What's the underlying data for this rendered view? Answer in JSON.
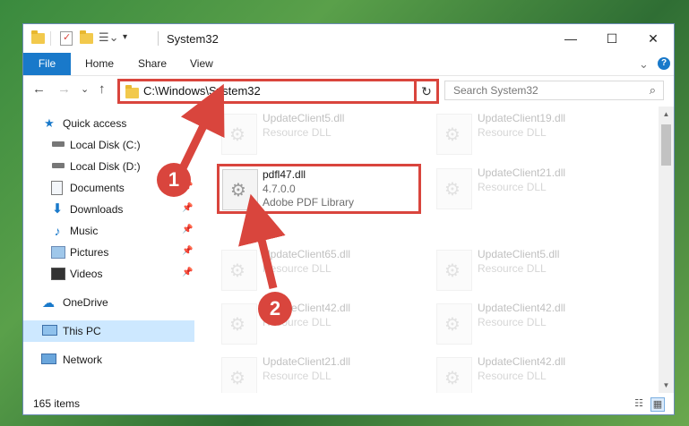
{
  "window": {
    "title": "System32",
    "controls": {
      "minimize": "—",
      "maximize": "☐",
      "close": "✕"
    }
  },
  "ribbon": {
    "tabs": [
      "File",
      "Home",
      "Share",
      "View"
    ],
    "expand": "⌄",
    "help": "?"
  },
  "nav": {
    "back": "←",
    "forward": "→",
    "recent": "⌄",
    "up": "↑"
  },
  "address": {
    "path": "C:\\Windows\\System32",
    "chevron": "⌄",
    "refresh": "↻"
  },
  "search": {
    "placeholder": "Search System32",
    "icon": "search-icon"
  },
  "sidebar": {
    "items": [
      {
        "label": "Quick access",
        "icon": "star-icon",
        "pinned": false
      },
      {
        "label": "Local Disk (C:)",
        "icon": "drive-icon",
        "pinned": false
      },
      {
        "label": "Local Disk (D:)",
        "icon": "drive-icon",
        "pinned": false
      },
      {
        "label": "Documents",
        "icon": "documents-icon",
        "pinned": true
      },
      {
        "label": "Downloads",
        "icon": "download-icon",
        "pinned": true
      },
      {
        "label": "Music",
        "icon": "music-icon",
        "pinned": true
      },
      {
        "label": "Pictures",
        "icon": "pictures-icon",
        "pinned": true
      },
      {
        "label": "Videos",
        "icon": "videos-icon",
        "pinned": true
      },
      {
        "label": "OneDrive",
        "icon": "cloud-icon",
        "pinned": false
      },
      {
        "label": "This PC",
        "icon": "computer-icon",
        "pinned": false,
        "selected": true
      },
      {
        "label": "Network",
        "icon": "network-icon",
        "pinned": false
      }
    ]
  },
  "files": {
    "left": [
      {
        "name": "UpdateClient5.dll",
        "type": "Resource DLL"
      },
      {
        "name": "pdfl47.dll",
        "version": "4.7.0.0",
        "description": "Adobe PDF Library"
      },
      {
        "name": "UpdateClient65.dll",
        "type": "Resource DLL"
      },
      {
        "name": "UpdateClient42.dll",
        "type": "Resource DLL"
      },
      {
        "name": "UpdateClient21.dll",
        "type": "Resource DLL"
      }
    ],
    "right": [
      {
        "name": "UpdateClient19.dll",
        "type": "Resource DLL"
      },
      {
        "name": "UpdateClient21.dll",
        "type": "Resource DLL"
      },
      {
        "name": "UpdateClient5.dll",
        "type": "Resource DLL"
      },
      {
        "name": "UpdateClient42.dll",
        "type": "Resource DLL"
      },
      {
        "name": "UpdateClient42.dll",
        "type": "Resource DLL"
      }
    ]
  },
  "status": {
    "count": "165 items"
  },
  "annotations": {
    "step1": "1",
    "step2": "2",
    "color": "#d9453d"
  }
}
